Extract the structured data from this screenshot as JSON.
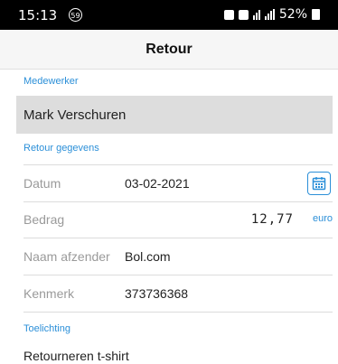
{
  "status_bar": {
    "time": "15:13",
    "notification_badge": "59",
    "battery": "52%"
  },
  "header": {
    "title": "Retour"
  },
  "employee_section": {
    "label": "Medewerker",
    "value": "Mark Verschuren"
  },
  "return_section": {
    "label": "Retour gegevens",
    "date": {
      "label": "Datum",
      "value": "03-02-2021"
    },
    "amount": {
      "label": "Bedrag",
      "value": "12,77",
      "unit": "euro"
    },
    "sender": {
      "label": "Naam afzender",
      "value": "Bol.com"
    },
    "reference": {
      "label": "Kenmerk",
      "value": "373736368"
    }
  },
  "explanation_section": {
    "label": "Toelichting",
    "value": "Retourneren t-shirt"
  },
  "colors": {
    "accent": "#2b8fd8",
    "field_background": "#dddddd",
    "header_background": "#f6f6f6"
  },
  "icons": {
    "calendar": "calendar-icon"
  }
}
